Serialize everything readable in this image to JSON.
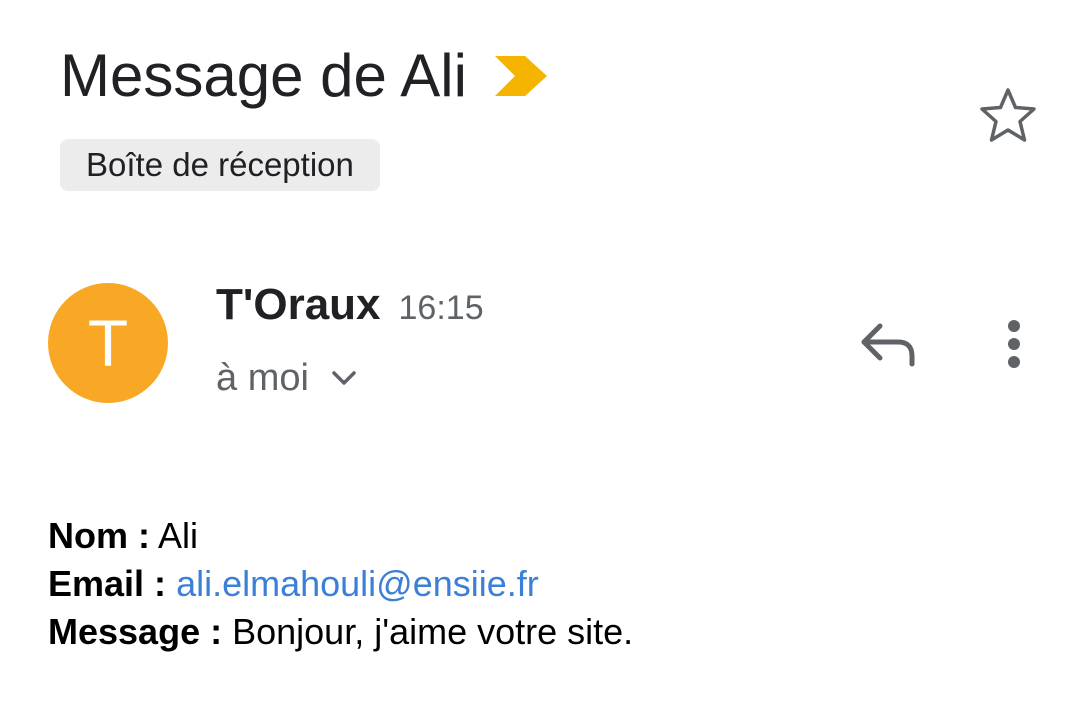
{
  "email": {
    "subject": "Message de Ali",
    "label": "Boîte de réception",
    "sender": {
      "initial": "T",
      "name": "T'Oraux",
      "time": "16:15",
      "recipient": "à moi"
    },
    "body": {
      "name_label": "Nom :",
      "name_value": "Ali",
      "email_label": "Email :",
      "email_value": "ali.elmahouli@ensiie.fr",
      "message_label": "Message :",
      "message_value": "Bonjour, j'aime votre site."
    }
  },
  "icons": {
    "importance": "importance-marker-icon",
    "star": "star-outline-icon",
    "chevron": "chevron-down-icon",
    "reply": "reply-icon",
    "more": "more-vert-icon"
  },
  "colors": {
    "avatar": "#f9a825",
    "importance": "#f4b400",
    "link": "#3c7fd6",
    "label_chip_bg": "#ececec",
    "secondary_text": "#5f6368"
  }
}
